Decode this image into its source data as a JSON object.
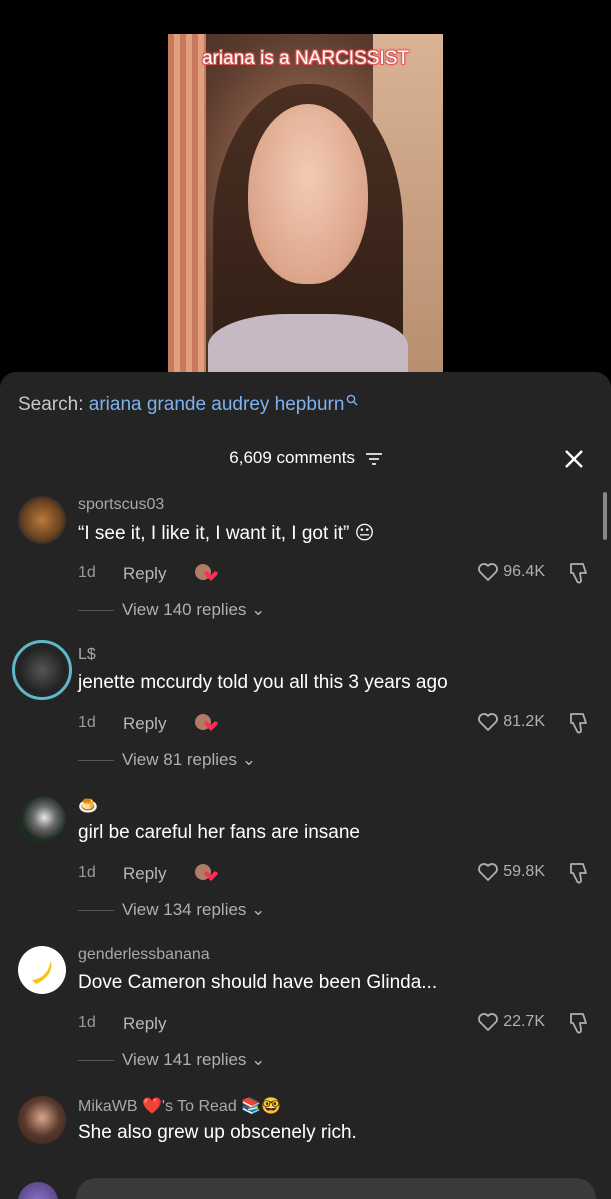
{
  "video": {
    "caption": "ariana is a NARCISSIST"
  },
  "search": {
    "label": "Search:",
    "query": "ariana grande audrey hepburn"
  },
  "comments_header": {
    "count_label": "6,609 comments"
  },
  "comments": [
    {
      "username": "sportscus03",
      "text": "“I see it, I like it, I want it, I got it” 😐",
      "time": "1d",
      "reply": "Reply",
      "likes": "96.4K",
      "view_replies": "View 140 replies"
    },
    {
      "username": "L$",
      "text": "jenette mccurdy told you all this 3 years ago",
      "time": "1d",
      "reply": "Reply",
      "likes": "81.2K",
      "view_replies": "View 81 replies"
    },
    {
      "username": "🍮",
      "text": "girl be careful her fans are insane",
      "time": "1d",
      "reply": "Reply",
      "likes": "59.8K",
      "view_replies": "View 134 replies"
    },
    {
      "username": "genderlessbanana",
      "text": "Dove Cameron should have been Glinda...",
      "time": "1d",
      "reply": "Reply",
      "likes": "22.7K",
      "view_replies": "View 141 replies"
    },
    {
      "username": "MikaWB ❤️'s To Read 📚🤓",
      "text": "She also grew up obscenely rich."
    }
  ],
  "colors": {
    "sheet_bg": "#242424",
    "search_query": "#7fb2ec",
    "caption_outline": "#e05a5a"
  }
}
